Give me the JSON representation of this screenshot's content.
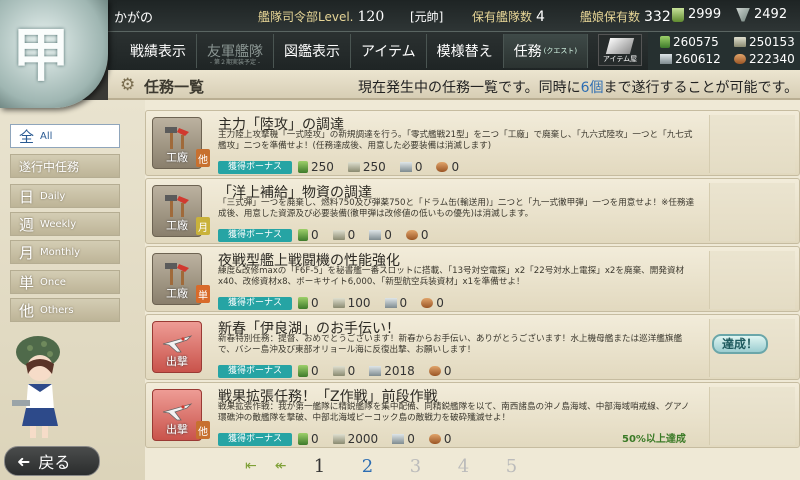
{
  "topbar": {
    "emblem_char": "甲",
    "player_name": "かがの",
    "hq_level_label": "艦隊司令部Level.",
    "hq_level": "120",
    "rank": "[元帥]",
    "fleet_count_label": "保有艦隊数",
    "fleet_count": "4",
    "ship_count_label": "艦娘保有数",
    "ship_count": "332",
    "buckets": "2999",
    "dev_materials": "2492"
  },
  "nav": {
    "items": [
      {
        "label": "戦績表示"
      },
      {
        "label": "友軍艦隊",
        "sub": "- 第２期実装予定 -"
      },
      {
        "label": "図鑑表示"
      },
      {
        "label": "アイテム"
      },
      {
        "label": "模様替え"
      },
      {
        "label": "任務",
        "tag": "(クエスト)"
      }
    ],
    "item_shop": "アイテム屋"
  },
  "resources": {
    "fuel": "260575",
    "ammo": "250153",
    "steel": "260612",
    "bauxite": "222340"
  },
  "header": {
    "title": "任務一覧",
    "notice_a": "現在発生中の任務一覧です。同時に",
    "notice_num": "6個",
    "notice_b": "まで遂行することが可能です。"
  },
  "filters": [
    {
      "big": "全",
      "en": "All"
    },
    {
      "big": "遂行中任務",
      "en": ""
    },
    {
      "big": "日",
      "en": "Daily"
    },
    {
      "big": "週",
      "en": "Weekly"
    },
    {
      "big": "月",
      "en": "Monthly"
    },
    {
      "big": "単",
      "en": "Once"
    },
    {
      "big": "他",
      "en": "Others"
    }
  ],
  "quests": [
    {
      "category": "工廠",
      "type": "arsenal",
      "badge": "他",
      "badge_type": "daily",
      "title": "主力「陸攻」の調達",
      "desc": "主力陸上攻撃機「一式陸攻」の新規調達を行う。「零式艦戦21型」を二つ「工廠」で廃棄し、「九六式陸攻」一つと「九七式艦攻」二つを準備せよ！(任務達成後、用意した必要装備は消滅します)",
      "bonus": "獲得ボーナス",
      "rewards": [
        "250",
        "250",
        "0",
        "0"
      ]
    },
    {
      "category": "工廠",
      "type": "arsenal",
      "badge": "月",
      "badge_type": "monthly",
      "title": "「洋上補給」物資の調達",
      "desc": "「三式弾」一つを廃棄し、燃料750及び弾薬750と「ドラム缶(輸送用)」二つと「九一式徹甲弾」一つを用意せよ！※任務達成後、用意した資源及び必要装備(徹甲弾は改修値の低いもの優先)は消滅します。",
      "bonus": "獲得ボーナス",
      "rewards": [
        "0",
        "0",
        "0",
        "0"
      ]
    },
    {
      "category": "工廠",
      "type": "arsenal",
      "badge": "単",
      "badge_type": "once",
      "title": "夜戦型艦上戦闘機の性能強化",
      "desc": "練度&改修maxの「F6F-5」を秘書艦一番スロットに搭載、「13号対空電探」x2「22号対水上電探」x2を廃棄、開発資材x40、改修資材x8、ボーキサイト6,000、「新型航空兵装資材」x1を準備せよ！",
      "bonus": "獲得ボーナス",
      "rewards": [
        "0",
        "100",
        "0",
        "0"
      ]
    },
    {
      "category": "出撃",
      "type": "sortie",
      "badge": "",
      "badge_type": "",
      "title": "新春「伊良湖」のお手伝い！",
      "desc": "新春特別任務：提督、おめでとうございます！新春からお手伝い、ありがとうございます！水上機母艦または巡洋艦旗艦で、バシー島沖及び東部オリョール海に反復出撃、お願いします！",
      "bonus": "獲得ボーナス",
      "rewards": [
        "0",
        "0",
        "2018",
        "0"
      ]
    },
    {
      "category": "出撃",
      "type": "sortie",
      "badge": "他",
      "badge_type": "daily",
      "title": "戦果拡張任務！「Z作戦」前段作戦",
      "desc": "戦果拡張作戦：我が第一艦隊に精鋭艦隊を集中配備、同精鋭艦隊を以て、南西諸島の沖ノ島海域、中部海域哨戒線、グアノ環礁沖の敵艦隊を撃破、中部北海域ピーコック島の敵戦力を破砕殲滅せよ！",
      "bonus": "獲得ボーナス",
      "rewards": [
        "0",
        "2000",
        "0",
        "0"
      ]
    }
  ],
  "status": {
    "achieved": "達成！",
    "progress": "50%以上達成"
  },
  "pager": {
    "pages": [
      "1",
      "2",
      "3",
      "4",
      "5"
    ],
    "current": "2"
  },
  "back_label": "戻る"
}
